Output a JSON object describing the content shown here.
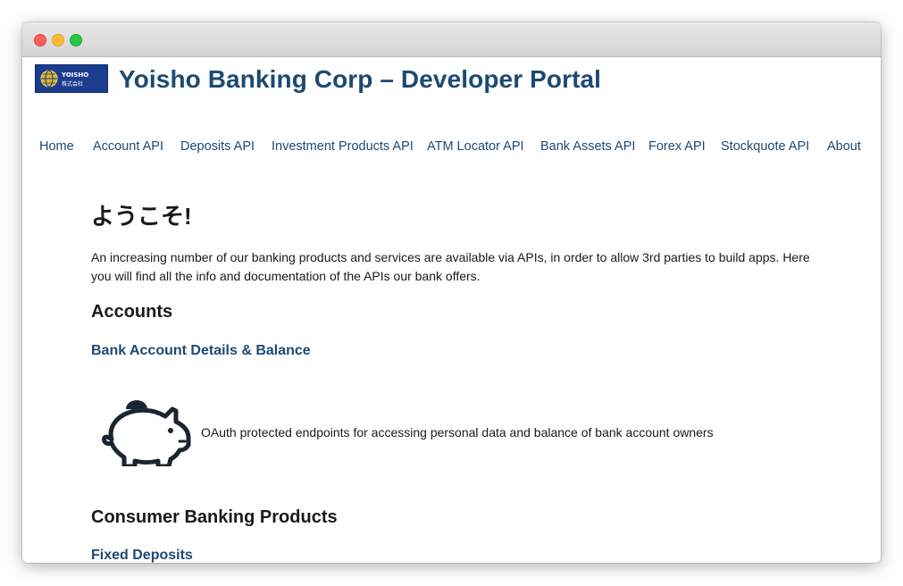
{
  "window": {
    "traffic_lights": [
      "close",
      "minimize",
      "zoom"
    ]
  },
  "header": {
    "logo_text": "YOISHO",
    "logo_subtext": "株式会社",
    "title": "Yoisho Banking Corp – Developer Portal"
  },
  "nav": {
    "items": [
      {
        "label": "Home"
      },
      {
        "label": "Account API"
      },
      {
        "label": "Deposits API"
      },
      {
        "label": "Investment Products API"
      },
      {
        "label": "ATM Locator API"
      },
      {
        "label": "Bank Assets API"
      },
      {
        "label": "Forex API"
      },
      {
        "label": "Stockquote API"
      },
      {
        "label": "About"
      }
    ]
  },
  "main": {
    "heading": "ようこそ!",
    "intro": "An increasing number of our banking products and services are available via APIs, in order to allow 3rd parties to build apps. Here you will find all the info and documentation of the APIs our bank offers.",
    "sections": [
      {
        "title": "Accounts",
        "link": "Bank Account Details & Balance",
        "icon": "piggy-bank-icon",
        "description": "OAuth protected endpoints for accessing personal data and balance of bank account owners"
      },
      {
        "title": "Consumer Banking Products",
        "link": "Fixed Deposits"
      }
    ]
  },
  "colors": {
    "brand_blue": "#1d4a72",
    "logo_bg": "#1a3d8f"
  }
}
